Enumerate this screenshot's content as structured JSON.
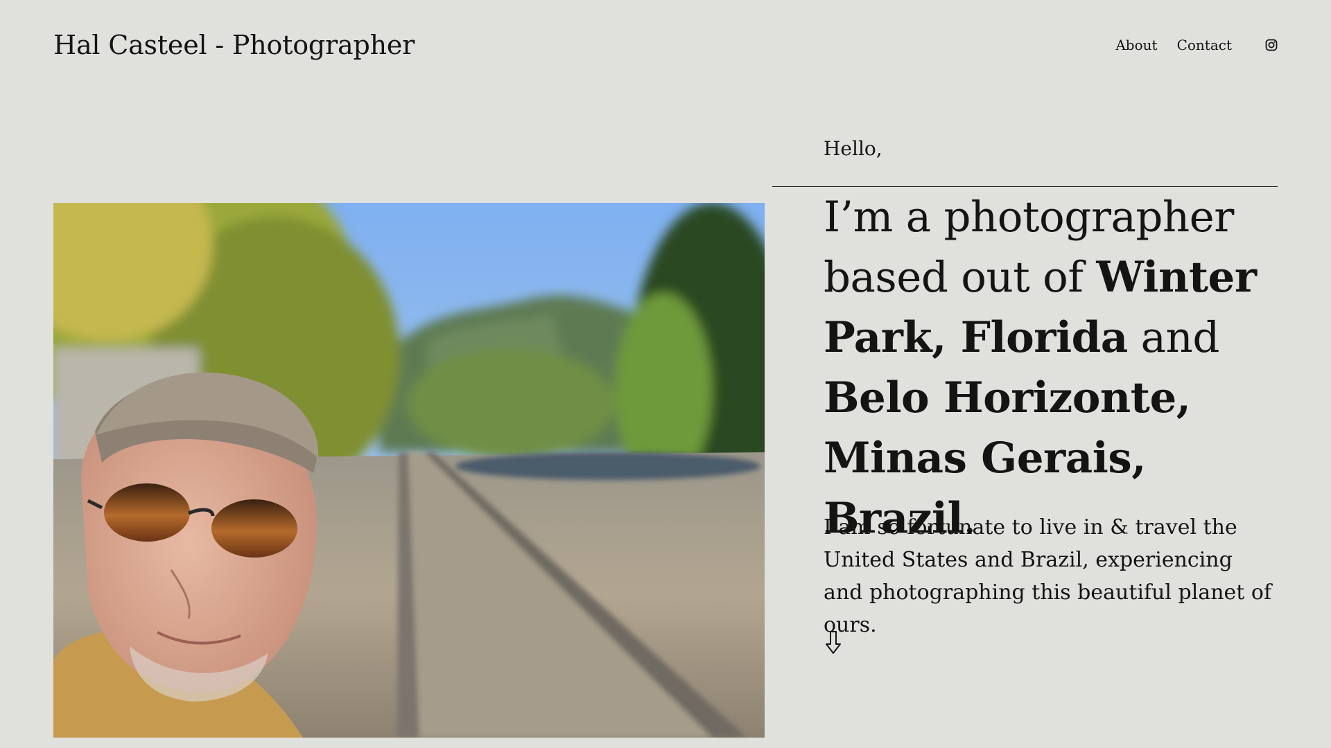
{
  "header": {
    "site_title": "Hal Casteel - Photographer",
    "nav": {
      "about": "About",
      "contact": "Contact"
    },
    "instagram_icon": "instagram-icon"
  },
  "hero": {
    "photo_icon": "portrait-photo",
    "greeting": "Hello,",
    "headline": {
      "part1": "I’m a photographer based out of ",
      "place1": "Winter Park, Florida",
      "conj": " and ",
      "place2": "Belo Horizonte, Minas Gerais, Brazil",
      "end": "."
    },
    "intro": "I am so fortunate to live in & travel the United States and Brazil, experiencing and photographing this beautiful planet of ours.",
    "scroll_icon": "arrow-down-icon"
  },
  "colors": {
    "background": "#e0e1dc",
    "text": "#141414"
  }
}
